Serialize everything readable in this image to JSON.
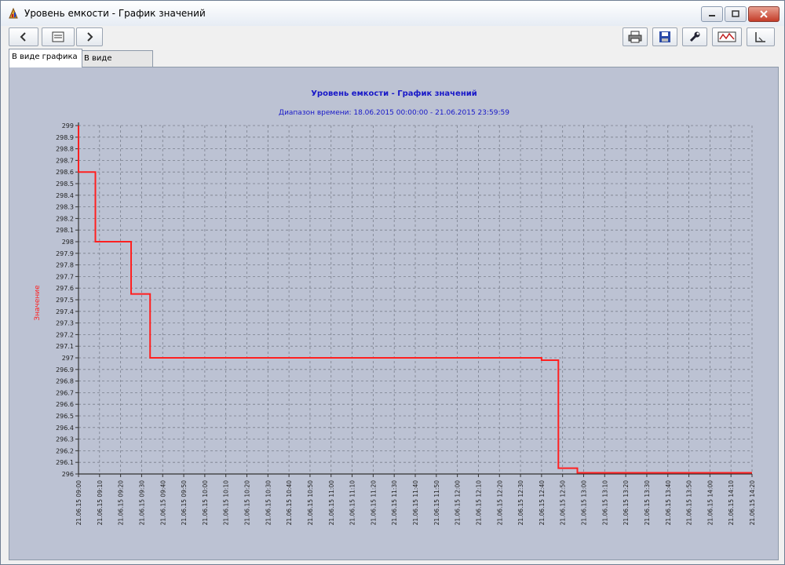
{
  "window": {
    "title": "Уровень емкости - График значений",
    "icon": "chart-app-icon"
  },
  "toolbar": {
    "left_buttons": [
      "back-icon",
      "print-preview-icon",
      "forward-icon"
    ],
    "right_buttons": [
      "print-icon",
      "save-icon",
      "settings-wrench-icon",
      "export-icon",
      "scale-icon"
    ]
  },
  "tabs": [
    {
      "label": "В виде графика",
      "active": true
    },
    {
      "label": "В виде таблицы",
      "active": false
    }
  ],
  "colors": {
    "plot_bg": "#bcc2d3",
    "series": "#ff2020",
    "title": "#1818c8",
    "ylabel": "#ff2020",
    "grid": "#7a7f8c"
  },
  "chart_data": {
    "type": "line",
    "step": true,
    "title": "Уровень емкости - График значений",
    "subtitle": "Диапазон времени: 18.06.2015 00:00:00 - 21.06.2015 23:59:59",
    "ylabel": "Значение",
    "xlabel": "",
    "ylim": [
      296,
      299
    ],
    "ytick_step": 0.1,
    "grid": true,
    "x_ticks": [
      "21.06.15 09:00",
      "21.06.15 09:10",
      "21.06.15 09:20",
      "21.06.15 09:30",
      "21.06.15 09:40",
      "21.06.15 09:50",
      "21.06.15 10:00",
      "21.06.15 10:10",
      "21.06.15 10:20",
      "21.06.15 10:30",
      "21.06.15 10:40",
      "21.06.15 10:50",
      "21.06.15 11:00",
      "21.06.15 11:10",
      "21.06.15 11:20",
      "21.06.15 11:30",
      "21.06.15 11:40",
      "21.06.15 11:50",
      "21.06.15 12:00",
      "21.06.15 12:10",
      "21.06.15 12:20",
      "21.06.15 12:30",
      "21.06.15 12:40",
      "21.06.15 12:50",
      "21.06.15 13:00",
      "21.06.15 13:10",
      "21.06.15 13:20",
      "21.06.15 13:30",
      "21.06.15 13:40",
      "21.06.15 13:50",
      "21.06.15 14:00",
      "21.06.15 14:10",
      "21.06.15 14:20"
    ],
    "series": [
      {
        "x": [
          "21.06.15 09:00",
          "21.06.15 09:00",
          "21.06.15 09:08",
          "21.06.15 09:08",
          "21.06.15 09:25",
          "21.06.15 09:25",
          "21.06.15 09:34",
          "21.06.15 09:34",
          "21.06.15 12:40",
          "21.06.15 12:40",
          "21.06.15 12:48",
          "21.06.15 12:48",
          "21.06.15 12:57",
          "21.06.15 12:57",
          "21.06.15 14:20"
        ],
        "values": [
          299.0,
          298.6,
          298.6,
          298.0,
          298.0,
          297.55,
          297.55,
          297.0,
          297.0,
          296.98,
          296.98,
          296.05,
          296.05,
          296.01,
          296.01
        ]
      }
    ]
  }
}
